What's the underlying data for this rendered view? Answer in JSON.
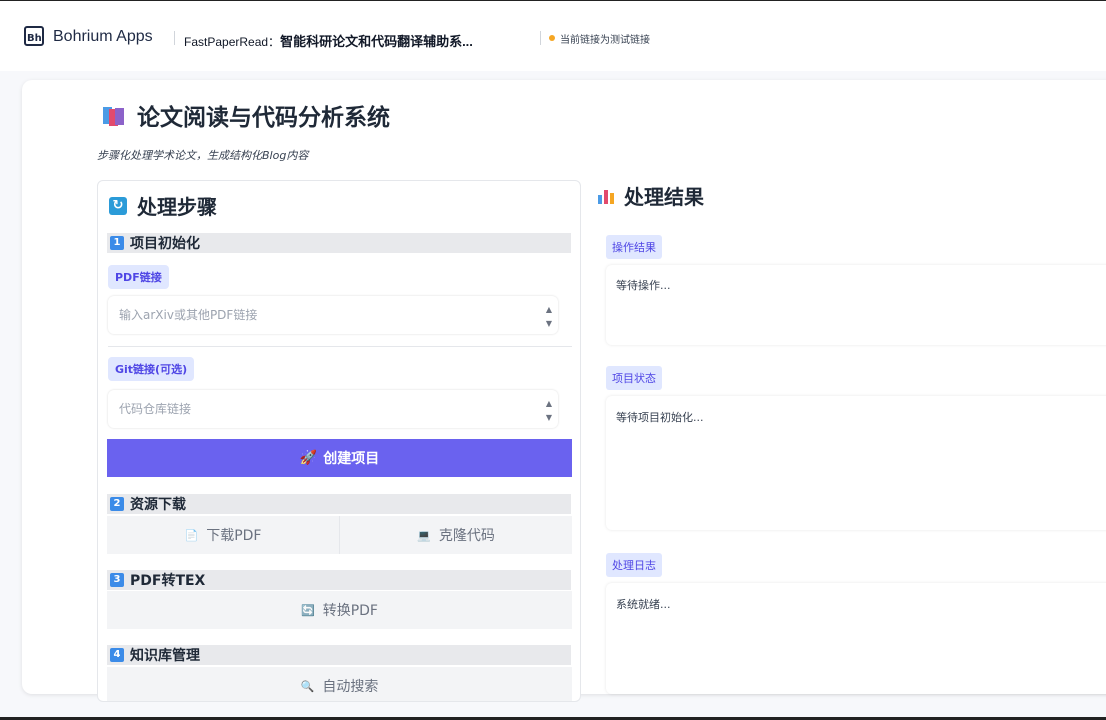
{
  "header": {
    "logo_text": "Bh",
    "brand": "Bohrium Apps",
    "app_title_prefix": "FastPaperRead：",
    "app_title_main": "智能科研论文和代码翻译辅助系...",
    "test_link_text": "当前链接为测试链接"
  },
  "page": {
    "title": "论文阅读与代码分析系统",
    "subtitle": "步骤化处理学术论文，生成结构化Blog内容"
  },
  "steps_panel": {
    "title": "处理步骤",
    "step1": {
      "num": "1",
      "title": "项目初始化",
      "pdf_label": "PDF链接",
      "pdf_placeholder": "输入arXiv或其他PDF链接",
      "git_label": "Git链接(可选)",
      "git_placeholder": "代码仓库链接",
      "create_button": "创建项目"
    },
    "step2": {
      "num": "2",
      "title": "资源下载",
      "download_pdf": "下载PDF",
      "clone_code": "克隆代码"
    },
    "step3": {
      "num": "3",
      "title": "PDF转TEX",
      "convert_pdf": "转换PDF"
    },
    "step4": {
      "num": "4",
      "title": "知识库管理",
      "auto_search": "自动搜索"
    }
  },
  "results_panel": {
    "title": "处理结果",
    "op_result_label": "操作结果",
    "op_result_text": "等待操作...",
    "project_status_label": "项目状态",
    "project_status_text": "等待项目初始化...",
    "log_label": "处理日志",
    "log_text": "系统就绪..."
  },
  "colors": {
    "primary": "#6a62ef",
    "chip_bg": "#e0e7ff",
    "chip_text": "#4f46e5",
    "step_num": "#3b8be8",
    "dot": "#f5a623"
  }
}
